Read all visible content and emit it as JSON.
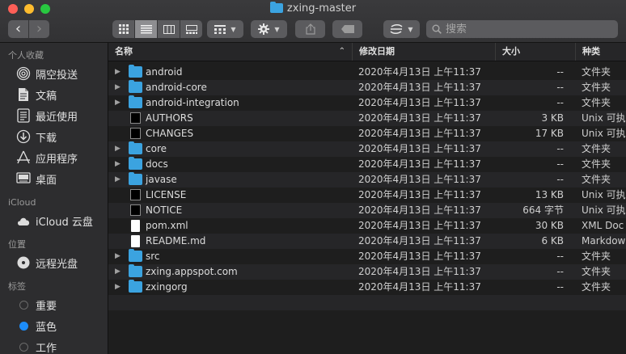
{
  "window": {
    "title": "zxing-master"
  },
  "toolbar": {
    "back_label": "‹",
    "forward_label": "›",
    "search_placeholder": "搜索"
  },
  "sidebar": {
    "sections": [
      {
        "heading": "个人收藏",
        "items": [
          {
            "label": "隔空投送",
            "icon": "airdrop-icon"
          },
          {
            "label": "文稿",
            "icon": "documents-icon"
          },
          {
            "label": "最近使用",
            "icon": "recents-icon"
          },
          {
            "label": "下载",
            "icon": "downloads-icon"
          },
          {
            "label": "应用程序",
            "icon": "applications-icon"
          },
          {
            "label": "桌面",
            "icon": "desktop-icon"
          }
        ]
      },
      {
        "heading": "iCloud",
        "items": [
          {
            "label": "iCloud 云盘",
            "icon": "icloud-icon"
          }
        ]
      },
      {
        "heading": "位置",
        "items": [
          {
            "label": "远程光盘",
            "icon": "remote-disc-icon"
          }
        ]
      },
      {
        "heading": "标签",
        "items": [
          {
            "label": "重要",
            "icon": "tag-gray-icon",
            "color": "#8e8e8e"
          },
          {
            "label": "蓝色",
            "icon": "tag-blue-icon",
            "color": "#1d8cf8"
          },
          {
            "label": "工作",
            "icon": "tag-work-icon",
            "color": "#8e8e8e"
          }
        ]
      }
    ]
  },
  "columns": {
    "name": "名称",
    "date": "修改日期",
    "size": "大小",
    "kind": "种类"
  },
  "files": [
    {
      "name": "android",
      "date": "2020年4月13日 上午11:37",
      "size": "--",
      "kind": "文件夹",
      "type": "folder"
    },
    {
      "name": "android-core",
      "date": "2020年4月13日 上午11:37",
      "size": "--",
      "kind": "文件夹",
      "type": "folder"
    },
    {
      "name": "android-integration",
      "date": "2020年4月13日 上午11:37",
      "size": "--",
      "kind": "文件夹",
      "type": "folder"
    },
    {
      "name": "AUTHORS",
      "date": "2020年4月13日 上午11:37",
      "size": "3 KB",
      "kind": "Unix 可执",
      "type": "exec"
    },
    {
      "name": "CHANGES",
      "date": "2020年4月13日 上午11:37",
      "size": "17 KB",
      "kind": "Unix 可执",
      "type": "exec"
    },
    {
      "name": "core",
      "date": "2020年4月13日 上午11:37",
      "size": "--",
      "kind": "文件夹",
      "type": "folder"
    },
    {
      "name": "docs",
      "date": "2020年4月13日 上午11:37",
      "size": "--",
      "kind": "文件夹",
      "type": "folder"
    },
    {
      "name": "javase",
      "date": "2020年4月13日 上午11:37",
      "size": "--",
      "kind": "文件夹",
      "type": "folder"
    },
    {
      "name": "LICENSE",
      "date": "2020年4月13日 上午11:37",
      "size": "13 KB",
      "kind": "Unix 可执",
      "type": "exec"
    },
    {
      "name": "NOTICE",
      "date": "2020年4月13日 上午11:37",
      "size": "664 字节",
      "kind": "Unix 可执",
      "type": "exec"
    },
    {
      "name": "pom.xml",
      "date": "2020年4月13日 上午11:37",
      "size": "30 KB",
      "kind": "XML Doc",
      "type": "doc"
    },
    {
      "name": "README.md",
      "date": "2020年4月13日 上午11:37",
      "size": "6 KB",
      "kind": "Markdow",
      "type": "doc"
    },
    {
      "name": "src",
      "date": "2020年4月13日 上午11:37",
      "size": "--",
      "kind": "文件夹",
      "type": "folder"
    },
    {
      "name": "zxing.appspot.com",
      "date": "2020年4月13日 上午11:37",
      "size": "--",
      "kind": "文件夹",
      "type": "folder"
    },
    {
      "name": "zxingorg",
      "date": "2020年4月13日 上午11:37",
      "size": "--",
      "kind": "文件夹",
      "type": "folder"
    }
  ],
  "colors": {
    "folder": "#3ba3e0",
    "accent_blue": "#1d8cf8"
  }
}
